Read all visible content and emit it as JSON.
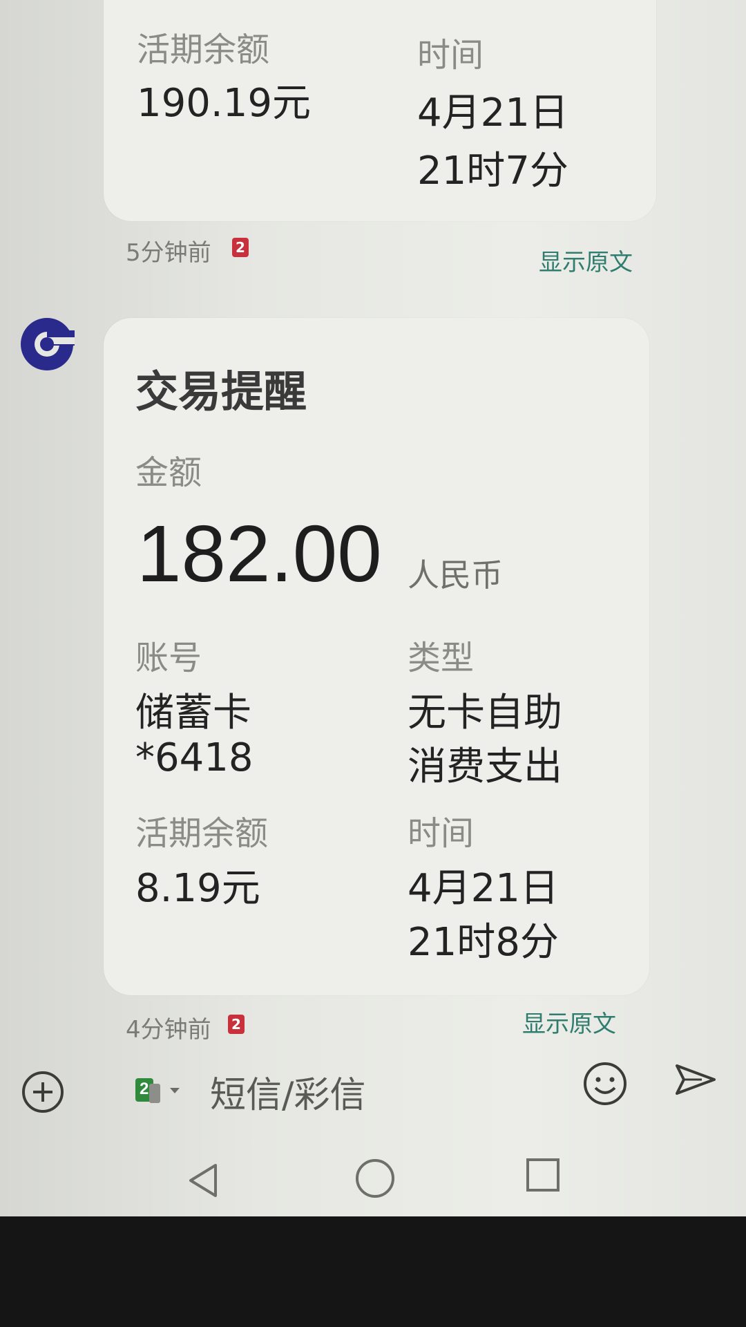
{
  "previous_message": {
    "balance_label": "活期余额",
    "balance_value": "190.19元",
    "time_label": "时间",
    "time_date": "4月21日",
    "time_clock": "21时7分",
    "received_ago": "5分钟前",
    "sim_badge": "2",
    "show_original": "显示原文"
  },
  "transaction_message": {
    "title": "交易提醒",
    "amount_label": "金额",
    "amount_value": "182.00",
    "currency": "人民币",
    "account_label": "账号",
    "account_type": "储蓄卡",
    "account_number": "*6418",
    "type_label": "类型",
    "type_line1": "无卡自助",
    "type_line2": "消费支出",
    "balance_label": "活期余额",
    "balance_value": "8.19元",
    "time_label": "时间",
    "time_date": "4月21日",
    "time_clock": "21时8分",
    "received_ago": "4分钟前",
    "sim_badge": "2",
    "show_original": "显示原文"
  },
  "composer": {
    "sim_label": "2",
    "placeholder": "短信/彩信"
  },
  "icons": {
    "bank_logo": "ccb-bank-logo",
    "add": "plus-circle-icon",
    "emoji": "smiley-icon",
    "send": "send-icon",
    "back": "back-triangle-icon",
    "home": "home-circle-icon",
    "recents": "recents-square-icon"
  },
  "colors": {
    "link": "#2f7d6f",
    "badge": "#c8303c",
    "logo": "#2a2a8c"
  }
}
